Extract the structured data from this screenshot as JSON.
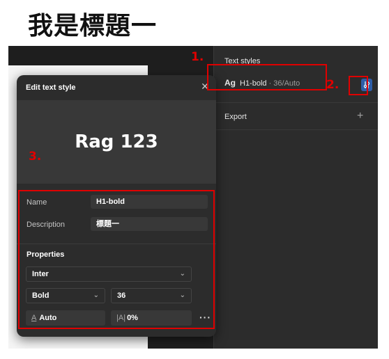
{
  "heading": "我是標題一",
  "right_panel": {
    "section_title": "Text styles",
    "style_row": {
      "sample": "Ag",
      "name": "H1-bold",
      "meta": " · 36/Auto"
    },
    "export_label": "Export",
    "add_icon": "plus-icon"
  },
  "modal": {
    "title": "Edit text style",
    "preview_text": "Rag 123",
    "name_label": "Name",
    "name_value": "H1-bold",
    "description_label": "Description",
    "description_value": "標題一",
    "properties_title": "Properties",
    "font_family": "Inter",
    "font_weight": "Bold",
    "font_size": "36",
    "line_height": "Auto",
    "letter_spacing_icon": "|A|",
    "letter_spacing": "0%"
  },
  "annotations": {
    "one": "1.",
    "two": "2.",
    "three": "3."
  },
  "colors": {
    "annotation_red": "#e00000",
    "accent_blue": "#2e5ea8",
    "panel_bg": "#2c2c2c"
  }
}
